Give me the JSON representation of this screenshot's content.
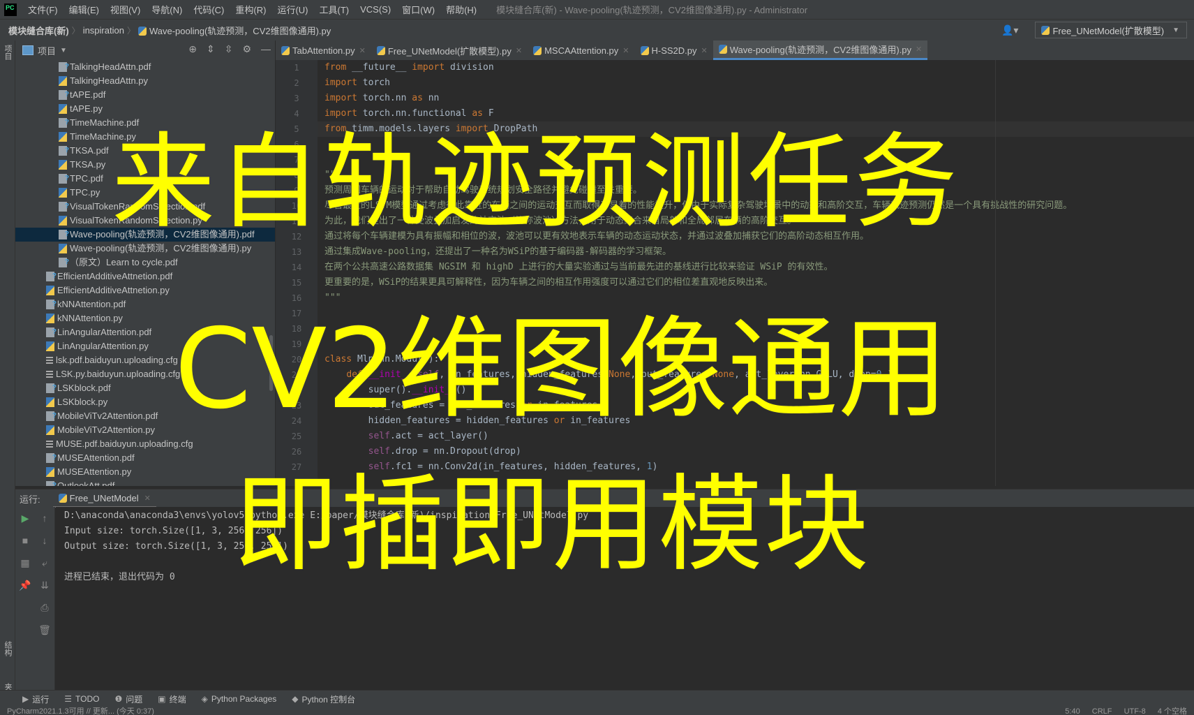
{
  "app": {
    "logo": "PC",
    "menu": [
      "文件(F)",
      "编辑(E)",
      "视图(V)",
      "导航(N)",
      "代码(C)",
      "重构(R)",
      "运行(U)",
      "工具(T)",
      "VCS(S)",
      "窗口(W)",
      "帮助(H)"
    ],
    "window_title": "模块缝合库(新) - Wave-pooling(轨迹预测，CV2维图像通用).py - Administrator"
  },
  "breadcrumb": {
    "items": [
      "模块缝合库(新)",
      "inspiration",
      "Wave-pooling(轨迹预测，CV2维图像通用).py"
    ],
    "separator": "〉"
  },
  "toolbar": {
    "user_icon": "user-icon",
    "run_config": "Free_UNetModel(扩散模型)"
  },
  "left_strip": {
    "project_label": "项目",
    "structure_label": "结构",
    "favorites_label": "收藏夹"
  },
  "project_panel": {
    "title": "项目",
    "tools": [
      "locate-icon",
      "expand-all-icon",
      "collapse-all-icon",
      "gear-icon",
      "hide-icon"
    ],
    "files": [
      {
        "name": "TalkingHeadAttn.pdf",
        "type": "pdf",
        "indent": 1
      },
      {
        "name": "TalkingHeadAttn.py",
        "type": "py",
        "indent": 1
      },
      {
        "name": "tAPE.pdf",
        "type": "pdf",
        "indent": 1
      },
      {
        "name": "tAPE.py",
        "type": "py",
        "indent": 1
      },
      {
        "name": "TimeMachine.pdf",
        "type": "pdf",
        "indent": 1
      },
      {
        "name": "TimeMachine.py",
        "type": "py",
        "indent": 1
      },
      {
        "name": "TKSA.pdf",
        "type": "pdf",
        "indent": 1
      },
      {
        "name": "TKSA.py",
        "type": "py",
        "indent": 1
      },
      {
        "name": "TPC.pdf",
        "type": "pdf",
        "indent": 1
      },
      {
        "name": "TPC.py",
        "type": "py",
        "indent": 1
      },
      {
        "name": "VisualTokenRandomSelection.pdf",
        "type": "pdf",
        "indent": 1
      },
      {
        "name": "VisualTokenRandomSelection.py",
        "type": "py",
        "indent": 1
      },
      {
        "name": "Wave-pooling(轨迹预测，CV2维图像通用).pdf",
        "type": "pdf",
        "indent": 1,
        "selected": true
      },
      {
        "name": "Wave-pooling(轨迹预测，CV2维图像通用).py",
        "type": "py",
        "indent": 1
      },
      {
        "name": "（原文）Learn to cycle.pdf",
        "type": "pdf",
        "indent": 1
      },
      {
        "name": "EfficientAdditiveAttnetion.pdf",
        "type": "pdf",
        "indent": 0
      },
      {
        "name": "EfficientAdditiveAttnetion.py",
        "type": "py",
        "indent": 0
      },
      {
        "name": "kNNAttention.pdf",
        "type": "pdf",
        "indent": 0
      },
      {
        "name": "kNNAttention.py",
        "type": "py",
        "indent": 0
      },
      {
        "name": "LinAngularAttention.pdf",
        "type": "pdf",
        "indent": 0
      },
      {
        "name": "LinAngularAttention.py",
        "type": "py",
        "indent": 0
      },
      {
        "name": "lsk.pdf.baiduyun.uploading.cfg",
        "type": "cfg",
        "indent": 0
      },
      {
        "name": "LSK.py.baiduyun.uploading.cfg",
        "type": "cfg",
        "indent": 0
      },
      {
        "name": "LSKblock.pdf",
        "type": "pdf",
        "indent": 0
      },
      {
        "name": "LSKblock.py",
        "type": "py",
        "indent": 0
      },
      {
        "name": "MobileViTv2Attention.pdf",
        "type": "pdf",
        "indent": 0
      },
      {
        "name": "MobileViTv2Attention.py",
        "type": "py",
        "indent": 0
      },
      {
        "name": "MUSE.pdf.baiduyun.uploading.cfg",
        "type": "cfg",
        "indent": 0
      },
      {
        "name": "MUSEAttention.pdf",
        "type": "pdf",
        "indent": 0
      },
      {
        "name": "MUSEAttention.py",
        "type": "py",
        "indent": 0
      },
      {
        "name": "OutlookAtt.pdf",
        "type": "pdf",
        "indent": 0
      }
    ]
  },
  "editor_tabs": [
    {
      "label": "TabAttention.py",
      "active": false
    },
    {
      "label": "Free_UNetModel(扩散模型).py",
      "active": false
    },
    {
      "label": "MSCAAttention.py",
      "active": false
    },
    {
      "label": "H-SS2D.py",
      "active": false
    },
    {
      "label": "Wave-pooling(轨迹预测，CV2维图像通用).py",
      "active": true
    }
  ],
  "editor": {
    "lines": [
      {
        "n": "1",
        "html": "<span class=\"kw\">from</span> __future__ <span class=\"kw\">import</span> division"
      },
      {
        "n": "2",
        "html": "<span class=\"kw\">import</span> torch"
      },
      {
        "n": "3",
        "html": "<span class=\"kw\">import</span> torch.nn <span class=\"kw\">as</span> nn"
      },
      {
        "n": "4",
        "html": "<span class=\"kw\">import</span> torch.nn.functional <span class=\"kw\">as</span> F"
      },
      {
        "n": "5",
        "html": "<span class=\"kw\">from</span> timm.models.layers <span class=\"kw\">import</span> DropPath",
        "current": true
      },
      {
        "n": "6",
        "html": ""
      },
      {
        "n": "7",
        "html": ""
      },
      {
        "n": "8",
        "html": "<span class=\"cm\">\"\"\"</span>"
      },
      {
        "n": "9",
        "html": "<span class=\"cm\">预测周围车辆的运动对于帮助自动驾驶系统规划安全路径并避免碰撞至关重要。</span>"
      },
      {
        "n": "10",
        "html": "<span class=\"cm\">尽管最近的LSTM模型通过考虑彼此靠近的车辆之间的运动交互而取得了显着的性能提升，但由于实际复杂驾驶场景中的动态和高阶交互，车辆轨迹预测仍然是一个具有挑战性的研究问题。</span>"
      },
      {
        "n": "11",
        "html": "<span class=\"cm\">为此，我们提出了一种受波叠加启发的社交池（简称波池）方法，用于动态聚合来自局部和全局邻居车辆的高阶交互。</span>"
      },
      {
        "n": "12",
        "html": "<span class=\"cm\">通过将每个车辆建模为具有振幅和相位的波，波池可以更有效地表示车辆的动态运动状态，并通过波叠加捕获它们的高阶动态相互作用。</span>"
      },
      {
        "n": "13",
        "html": "<span class=\"cm\">通过集成Wave-pooling，还提出了一种名为WSiP的基于编码器-解码器的学习框架。</span>"
      },
      {
        "n": "14",
        "html": "<span class=\"cm\">在两个公共高速公路数据集 NGSIM 和 highD 上进行的大量实验通过与当前最先进的基线进行比较来验证 WSiP 的有效性。</span>"
      },
      {
        "n": "15",
        "html": "<span class=\"cm\">更重要的是，WSiP的结果更具可解释性，因为车辆之间的相互作用强度可以通过它们的相位差直观地反映出来。</span>"
      },
      {
        "n": "16",
        "html": "<span class=\"cm\">\"\"\"</span>"
      },
      {
        "n": "17",
        "html": ""
      },
      {
        "n": "18",
        "html": ""
      },
      {
        "n": "19",
        "html": ""
      },
      {
        "n": "20",
        "html": "<span class=\"kw\">class</span> Mlp(nn.Module):"
      },
      {
        "n": "21",
        "html": "    <span class=\"kw\">def</span> <span class=\"magic\">__init__</span>(<span class=\"self\">self</span>, in_features, hidden_features=<span class=\"kw\">None</span>, out_features=<span class=\"kw\">None</span>, act_layer=nn.GELU, drop=<span class=\"num\">0.</span>):"
      },
      {
        "n": "22",
        "html": "        super().<span class=\"magic\">__init__</span>()"
      },
      {
        "n": "23",
        "html": "        out_features = out_features <span class=\"kw\">or</span> in_features"
      },
      {
        "n": "24",
        "html": "        hidden_features = hidden_features <span class=\"kw\">or</span> in_features"
      },
      {
        "n": "25",
        "html": "        <span class=\"self\">self</span>.act = act_layer()"
      },
      {
        "n": "26",
        "html": "        <span class=\"self\">self</span>.drop = nn.Dropout(drop)"
      },
      {
        "n": "27",
        "html": "        <span class=\"self\">self</span>.fc1 = nn.Conv2d(in_features, hidden_features, <span class=\"num\">1</span>)"
      }
    ]
  },
  "run_panel": {
    "label": "运行:",
    "tab": "Free_UNetModel",
    "output": [
      "D:\\anaconda\\anaconda3\\envs\\yolov5\\python.exe E:/paper/模块缝合库(新)/inspiration/Free_UNetModel.py",
      "Input size: torch.Size([1, 3, 256, 256])",
      "Output size: torch.Size([1, 3, 256, 256])",
      "",
      "进程已结束，退出代码为 0"
    ]
  },
  "bottom_tabs": [
    {
      "icon": "▶",
      "label": "运行"
    },
    {
      "icon": "☰",
      "label": "TODO"
    },
    {
      "icon": "❶",
      "label": "问题"
    },
    {
      "icon": "▣",
      "label": "终端"
    },
    {
      "icon": "◈",
      "label": "Python Packages"
    },
    {
      "icon": "◆",
      "label": "Python 控制台"
    }
  ],
  "status_bar": {
    "left": "PyCharm2021.1.3可用 // 更新... (今天 0:37)",
    "position": "5:40",
    "line_ending": "CRLF",
    "encoding": "UTF-8",
    "indent": "4 个空格"
  },
  "overlay": {
    "line1": "来自轨迹预测任务",
    "line2": "CV2维图像通用",
    "line3": "即插即用模块",
    "color": "#ffff00"
  }
}
